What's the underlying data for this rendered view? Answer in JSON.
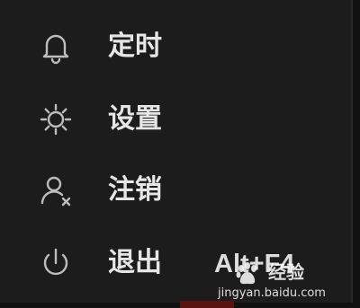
{
  "menu": {
    "items": [
      {
        "label": "定时",
        "icon": "bell-icon",
        "shortcut": ""
      },
      {
        "label": "设置",
        "icon": "gear-icon",
        "shortcut": ""
      },
      {
        "label": "注销",
        "icon": "user-logout-icon",
        "shortcut": ""
      },
      {
        "label": "退出",
        "icon": "power-icon",
        "shortcut": "Alt+F4"
      }
    ]
  },
  "watermark": {
    "brand": "经验",
    "url": "jingyan.baidu.com"
  },
  "colors": {
    "background": "#1c1c1c",
    "text": "#e6e6e6",
    "icon": "#bdbdbd"
  }
}
